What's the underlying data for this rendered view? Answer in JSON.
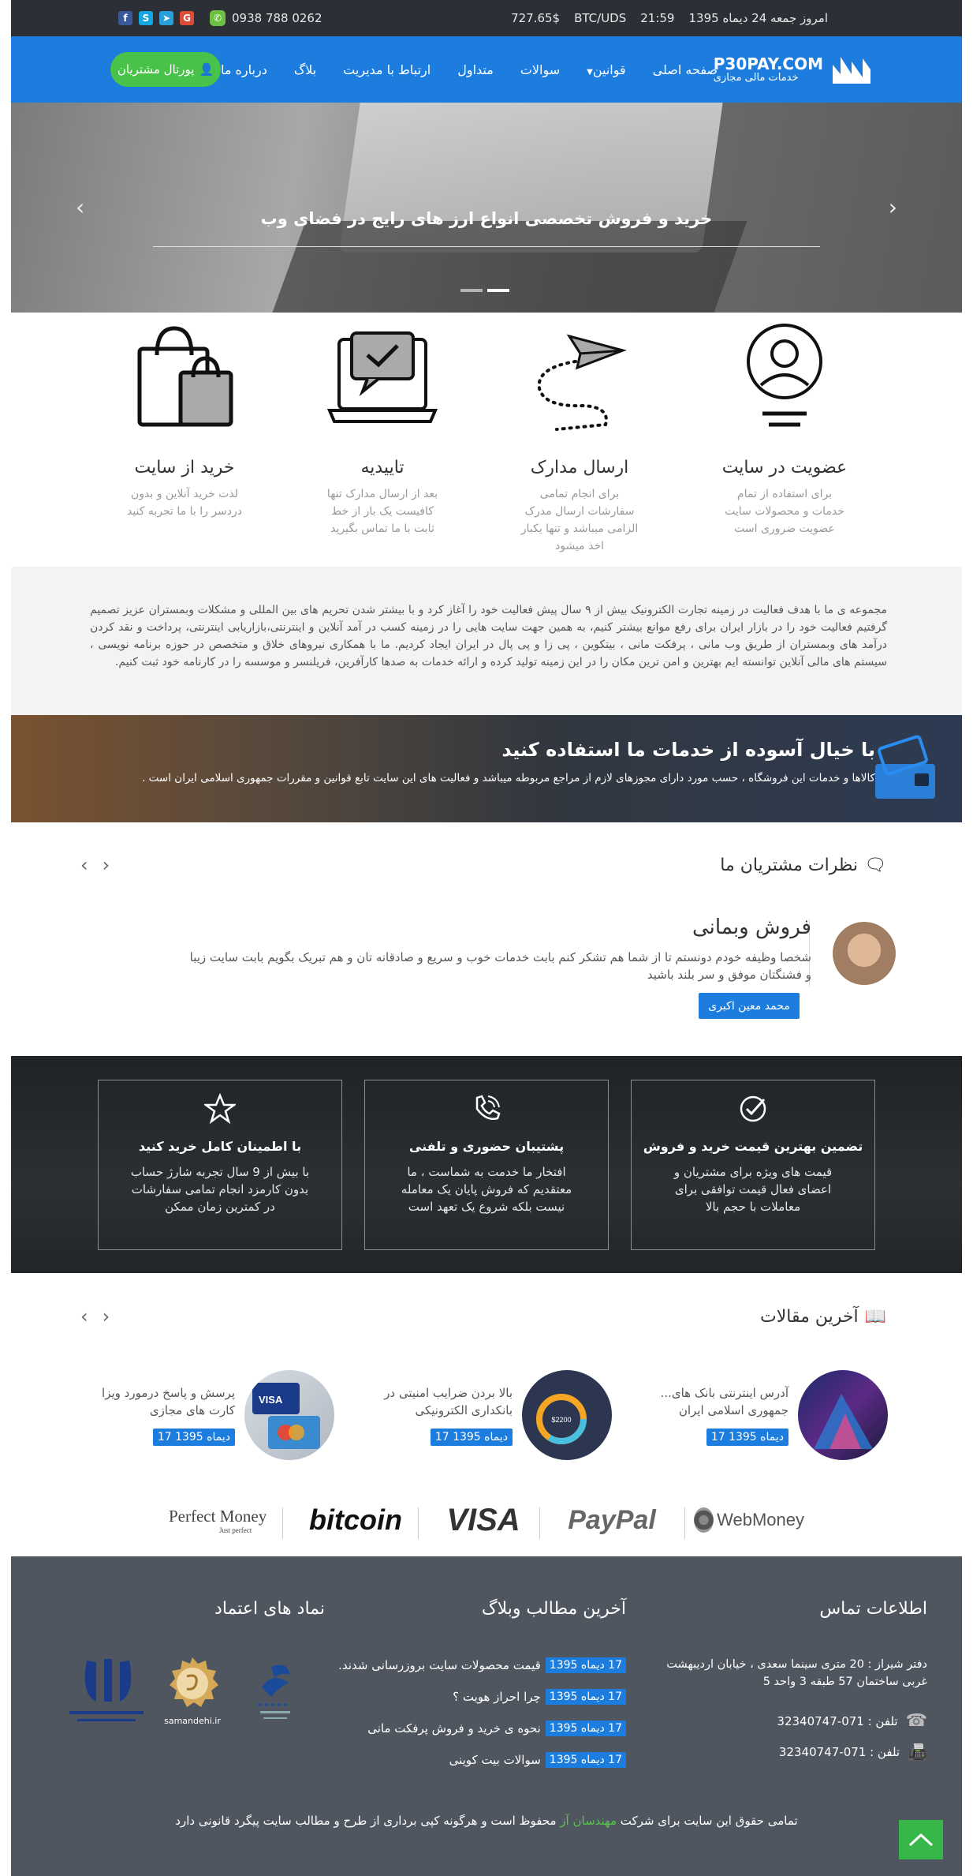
{
  "topbar": {
    "date": "امروز جمعه 24 دیماه 1395",
    "time": "21:59",
    "pair": "BTC/UDS",
    "price": "727.65$",
    "phone": "0938 788 0262",
    "social_icons": [
      "google-icon",
      "telegram-icon",
      "skype-icon",
      "facebook-icon"
    ]
  },
  "nav": {
    "logo_title": "P30PAY.COM",
    "logo_subtitle": "خدمات مالی مجازی",
    "menu": [
      "صفحه اصلی",
      "قوانین",
      "سوالات",
      "متداول",
      "ارتباط با مدیریت",
      "بلاگ",
      "درباره ما"
    ],
    "portal": "پورتال مشتریان"
  },
  "hero": {
    "caption": "خرید و فروش تخصصی انواع ارز های رایج در فضای وب"
  },
  "features": [
    {
      "title": "عضویت در سایت",
      "text": "برای استفاده از تمام خدمات و محصولات سایت عضویت ضروری است"
    },
    {
      "title": "ارسال مدارک",
      "text": "برای انجام تمامی سفارشات ارسال مدرک الزامی میباشد و تنها یکبار اخذ میشود"
    },
    {
      "title": "تاییدیه",
      "text": "بعد از ارسال مدارک تنها کافیست یک بار از خط ثابت با ما تماس بگیرید"
    },
    {
      "title": "خرید از سایت",
      "text": "لذت خرید آنلاین و بدون دردسر را با ما تجربه کنید"
    }
  ],
  "about": {
    "text": "مجموعه ی ما با هدف فعالیت در زمینه تجارت الکترونیک بیش از ۹ سال پیش فعالیت خود را آغاز کرد و با بیشتر شدن تحریم های بین المللی و مشکلات وبمستران عزیز تصمیم گرفتیم فعالیت خود را در بازار ایران برای رفع موانع بیشتر کنیم، به همین جهت سایت هایی را در زمینه کسب در آمد آنلاین و اینترنتی،بازاریابی اینترنتی، پرداخت و نقد کردن درآمد های وبمستران از طریق وب مانی ، پرفکت مانی ، بیتکوین ، پی زا و پی پال در ایران ایجاد کردیم. ما با همکاری نیروهای خلاق و متخصص در حوزه برنامه نویسی ، سیستم های مالی آنلاین توانسته ایم بهترین و امن ترین مکان را در این زمینه تولید کرده و ارائه خدمات به صدها کارآفرین، فریلنسر و موسسه را در کارنامه خود ثبت کنیم."
  },
  "banner": {
    "title": "با خیال آسوده از خدمات ما استفاده کنید",
    "subtitle": "کالاها و خدمات این فروشگاه ، حسب مورد دارای مجوزهای لازم از مراجع مربوطه میباشد و فعالیت های این سایت تابع قوانین و مقررات جمهوری اسلامی ایران است ."
  },
  "testimonials": {
    "heading": "نظرات مشتریان ما",
    "name": "فروش وبمانی",
    "text": "شخصا وظیفه خودم دونستم تا از شما هم تشکر کنم بابت خدمات خوب و سریع و صادقانه تان و هم تبریک بگویم بابت سایت زیبا و فشنگتان موفق و سر بلند باشید",
    "author": "محمد معین اکبری"
  },
  "services": [
    {
      "title": "تضمین بهترین قیمت خرید و فروش",
      "text": "قیمت های ویژه برای مشتریان و اعضای فعال قیمت توافقی برای معاملات با حجم بالا"
    },
    {
      "title": "پشتیبان حضوری و تلفنی",
      "text": "افتخار ما خدمت به شماست ، ما معتقدیم که فروش پایان یک معامله نیست بلکه شروع یک تعهد است"
    },
    {
      "title": "با اطمینان کامل خرید کنید",
      "text": "با بیش از 9 سال تجربه شارژ حساب بدون کارمزد انجام تمامی سفارشات در کمترین زمان ممکن"
    }
  ],
  "articles": {
    "heading": "آخرین مقالات",
    "items": [
      {
        "title": "آدرس اینترنتی بانک های... جمهوری اسلامی ایران",
        "date": "17 دیماه 1395"
      },
      {
        "title": "بالا بردن ضرایب امنیتی در بانکداری الکترونیکی",
        "date": "17 دیماه 1395"
      },
      {
        "title": "پرسش و پاسخ درمورد ویزا کارت های مجازی",
        "date": "17 دیماه 1395"
      }
    ]
  },
  "payments": {
    "webmoney": "WebMoney",
    "paypal": "PayPal",
    "visa": "VISA",
    "bitcoin": "bitcoin",
    "perfect": "Perfect Money",
    "perfect_sub": "Just perfect"
  },
  "footer": {
    "contact_heading": "اطلاعات تماس",
    "address": "دفتر شیراز : 20 متری سینما سعدی ، خیابان اردیبهشت غربی ساختمان 57 طبقه 3 واحد 5",
    "tel1": "تلفن : 071-32340747",
    "tel2": "تلفن : 071-32340747",
    "posts_heading": "آخرین مطالب وبلاگ",
    "posts": [
      {
        "date": "17 دیماه 1395",
        "title": "قیمت محصولات سایت بروزرسانی شدند."
      },
      {
        "date": "17 دیماه 1395",
        "title": "چرا احراز هویت ؟"
      },
      {
        "date": "17 دیماه 1395",
        "title": "نحوه ی خرید و فروش پرفکت مانی"
      },
      {
        "date": "17 دیماه 1395",
        "title": "سوالات بیت کوینی"
      }
    ],
    "trust_heading": "نماد های اعتماد",
    "samandehi": "samandehi.ir",
    "copyright_a": "تمامی حقوق این سایت برای شرکت",
    "copyright_company": "مهندسان آز",
    "copyright_b": "محفوظ است و هرگونه کپی برداری از طرح و مطالب سایت پیگرد قانونی دارد"
  }
}
